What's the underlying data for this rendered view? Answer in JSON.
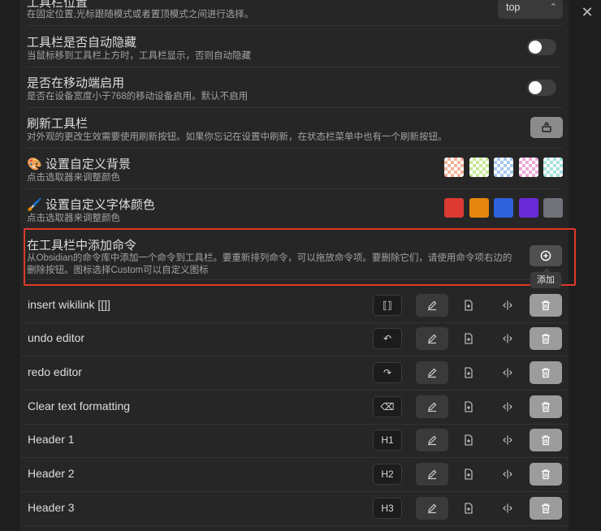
{
  "settings": {
    "toolbar_position": {
      "name": "工具栏位置",
      "desc": "在固定位置,光标跟随模式或者置顶模式之间进行选择。",
      "value": "top"
    },
    "auto_hide": {
      "name": "工具栏是否自动隐藏",
      "desc": "当鼠标移到工具栏上方时，工具栏显示，否则自动隐藏",
      "enabled": false
    },
    "mobile_enable": {
      "name": "是否在移动端启用",
      "desc": "是否在设备宽度小于768的移动设备启用。默认不启用",
      "enabled": false
    },
    "refresh": {
      "name": "刷新工具栏",
      "desc": "对外观的更改生效需要使用刷新按钮。如果你忘记在设置中刷新，在状态栏菜单中也有一个刷新按钮。"
    },
    "custom_bg": {
      "name": "🎨 设置自定义背景",
      "desc": "点击选取器来调整颜色",
      "swatches": [
        "#f0b39a",
        "#c8e89a",
        "#a9c8ef",
        "#e9a9d6",
        "#a6e0de"
      ]
    },
    "custom_font_color": {
      "name": "🖌️ 设置自定义字体颜色",
      "desc": "点击选取器来调整颜色",
      "swatches": [
        "#dc3a33",
        "#e6860e",
        "#2f62dc",
        "#6a2ad6",
        "#6f7278"
      ]
    },
    "add_command": {
      "name": "在工具栏中添加命令",
      "desc": "从Obsidian的命令库中添加一个命令到工具栏。要重新排列命令，可以拖放命令项。要删除它们，请使用命令项右边的删除按钮。图标选择Custom可以自定义图标",
      "tooltip": "添加"
    }
  },
  "commands": [
    {
      "label": "insert wikilink [[]]",
      "icon": "⟦⟧",
      "icon_name": "wikilink-icon"
    },
    {
      "label": "undo editor",
      "icon": "↶",
      "icon_name": "undo-icon"
    },
    {
      "label": "redo editor",
      "icon": "↷",
      "icon_name": "redo-icon"
    },
    {
      "label": "Clear text formatting",
      "icon": "⌫",
      "icon_name": "eraser-icon"
    },
    {
      "label": "Header 1",
      "icon": "H1",
      "icon_name": "h1-icon"
    },
    {
      "label": "Header 2",
      "icon": "H2",
      "icon_name": "h2-icon"
    },
    {
      "label": "Header 3",
      "icon": "H3",
      "icon_name": "h3-icon"
    }
  ],
  "colors": {
    "highlight_border": "#e0392a",
    "panel_bg": "#262626"
  }
}
